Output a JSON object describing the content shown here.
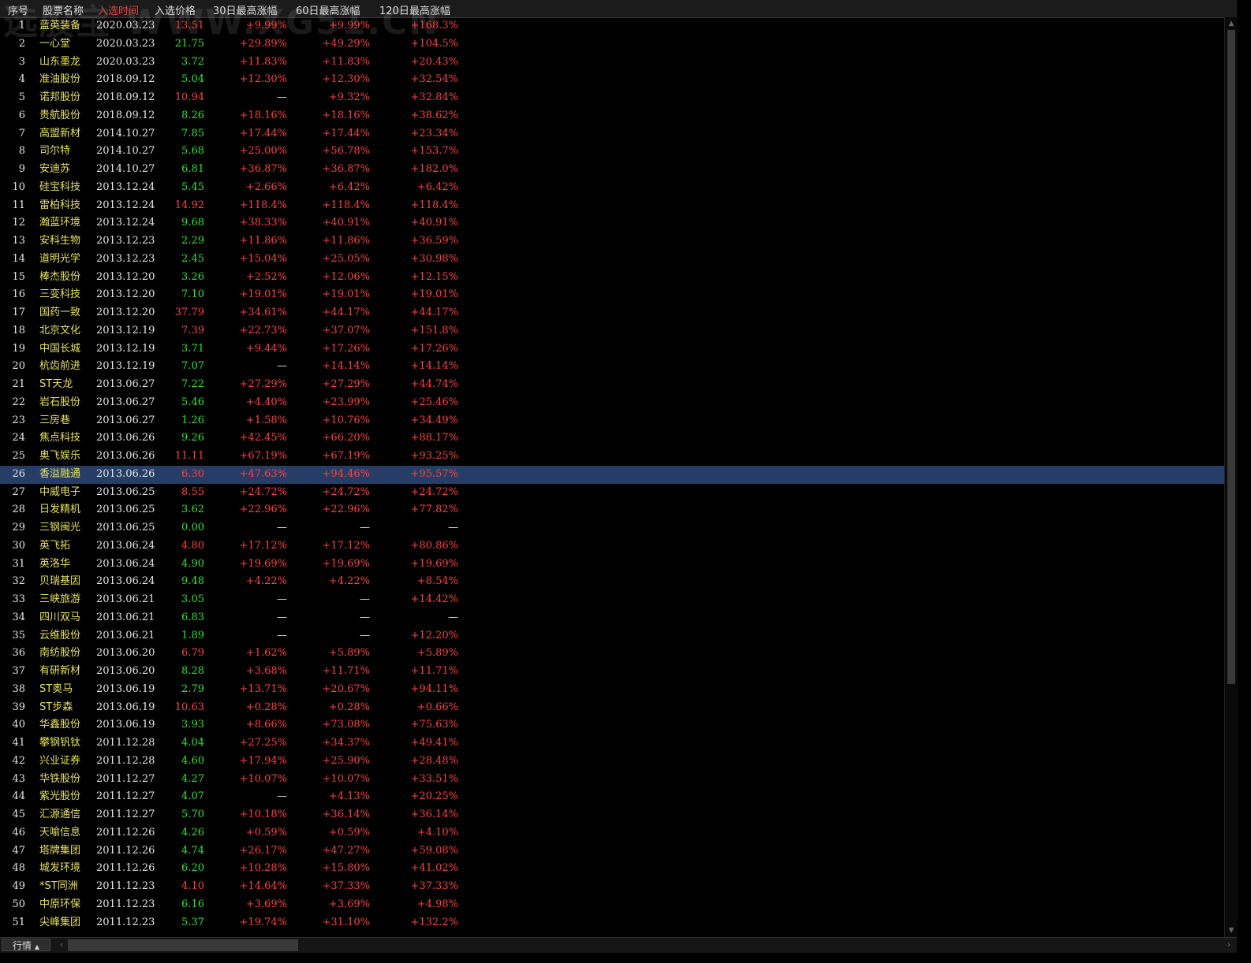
{
  "header": {
    "columns": [
      "序号",
      "股票名称",
      "入选时间",
      "入选价格",
      "30日最高涨幅",
      "60日最高涨幅",
      "120日最高涨幅"
    ],
    "sorted_column_index": 2,
    "watermark": "选股宝 WWW.XG51.CN"
  },
  "colors": {
    "up": "#ff4040",
    "down": "#2ee62e",
    "name": "#e6e15a",
    "selected_row": "#263e66",
    "sorted_header": "#e0443d"
  },
  "selected_row": 26,
  "rows": [
    {
      "idx": "1",
      "name": "蓝英装备",
      "date": "2020.03.23",
      "price": "13.51",
      "price_dir": "up",
      "g30": "+9.99%",
      "g60": "+9.99%",
      "g120": "+168.3%"
    },
    {
      "idx": "2",
      "name": "一心堂",
      "date": "2020.03.23",
      "price": "21.75",
      "price_dir": "down",
      "g30": "+29.89%",
      "g60": "+49.29%",
      "g120": "+104.5%"
    },
    {
      "idx": "3",
      "name": "山东墨龙",
      "date": "2020.03.23",
      "price": "3.72",
      "price_dir": "down",
      "g30": "+11.83%",
      "g60": "+11.83%",
      "g120": "+20.43%"
    },
    {
      "idx": "4",
      "name": "准油股份",
      "date": "2018.09.12",
      "price": "5.04",
      "price_dir": "down",
      "g30": "+12.30%",
      "g60": "+12.30%",
      "g120": "+32.54%"
    },
    {
      "idx": "5",
      "name": "诺邦股份",
      "date": "2018.09.12",
      "price": "10.94",
      "price_dir": "up",
      "g30": "—",
      "g60": "+9.32%",
      "g120": "+32.84%"
    },
    {
      "idx": "6",
      "name": "贵航股份",
      "date": "2018.09.12",
      "price": "8.26",
      "price_dir": "down",
      "g30": "+18.16%",
      "g60": "+18.16%",
      "g120": "+38.62%"
    },
    {
      "idx": "7",
      "name": "高盟新材",
      "date": "2014.10.27",
      "price": "7.85",
      "price_dir": "down",
      "g30": "+17.44%",
      "g60": "+17.44%",
      "g120": "+23.34%"
    },
    {
      "idx": "8",
      "name": "司尔特",
      "date": "2014.10.27",
      "price": "5.68",
      "price_dir": "down",
      "g30": "+25.00%",
      "g60": "+56.78%",
      "g120": "+153.7%"
    },
    {
      "idx": "9",
      "name": "安迪苏",
      "date": "2014.10.27",
      "price": "6.81",
      "price_dir": "down",
      "g30": "+36.87%",
      "g60": "+36.87%",
      "g120": "+182.0%"
    },
    {
      "idx": "10",
      "name": "硅宝科技",
      "date": "2013.12.24",
      "price": "5.45",
      "price_dir": "down",
      "g30": "+2.66%",
      "g60": "+6.42%",
      "g120": "+6.42%"
    },
    {
      "idx": "11",
      "name": "雷柏科技",
      "date": "2013.12.24",
      "price": "14.92",
      "price_dir": "up",
      "g30": "+118.4%",
      "g60": "+118.4%",
      "g120": "+118.4%"
    },
    {
      "idx": "12",
      "name": "瀚蓝环境",
      "date": "2013.12.24",
      "price": "9.68",
      "price_dir": "down",
      "g30": "+38.33%",
      "g60": "+40.91%",
      "g120": "+40.91%"
    },
    {
      "idx": "13",
      "name": "安科生物",
      "date": "2013.12.23",
      "price": "2.29",
      "price_dir": "down",
      "g30": "+11.86%",
      "g60": "+11.86%",
      "g120": "+36.59%"
    },
    {
      "idx": "14",
      "name": "道明光学",
      "date": "2013.12.23",
      "price": "2.45",
      "price_dir": "down",
      "g30": "+15.04%",
      "g60": "+25.05%",
      "g120": "+30.98%"
    },
    {
      "idx": "15",
      "name": "棒杰股份",
      "date": "2013.12.20",
      "price": "3.26",
      "price_dir": "down",
      "g30": "+2.52%",
      "g60": "+12.06%",
      "g120": "+12.15%"
    },
    {
      "idx": "16",
      "name": "三变科技",
      "date": "2013.12.20",
      "price": "7.10",
      "price_dir": "down",
      "g30": "+19.01%",
      "g60": "+19.01%",
      "g120": "+19.01%"
    },
    {
      "idx": "17",
      "name": "国药一致",
      "date": "2013.12.20",
      "price": "37.79",
      "price_dir": "up",
      "g30": "+34.61%",
      "g60": "+44.17%",
      "g120": "+44.17%"
    },
    {
      "idx": "18",
      "name": "北京文化",
      "date": "2013.12.19",
      "price": "7.39",
      "price_dir": "up",
      "g30": "+22.73%",
      "g60": "+37.07%",
      "g120": "+151.8%"
    },
    {
      "idx": "19",
      "name": "中国长城",
      "date": "2013.12.19",
      "price": "3.71",
      "price_dir": "down",
      "g30": "+9.44%",
      "g60": "+17.26%",
      "g120": "+17.26%"
    },
    {
      "idx": "20",
      "name": "杭齿前进",
      "date": "2013.12.19",
      "price": "7.07",
      "price_dir": "down",
      "g30": "—",
      "g60": "+14.14%",
      "g120": "+14.14%"
    },
    {
      "idx": "21",
      "name": "ST天龙",
      "date": "2013.06.27",
      "price": "7.22",
      "price_dir": "down",
      "g30": "+27.29%",
      "g60": "+27.29%",
      "g120": "+44.74%"
    },
    {
      "idx": "22",
      "name": "岩石股份",
      "date": "2013.06.27",
      "price": "5.46",
      "price_dir": "down",
      "g30": "+4.40%",
      "g60": "+23.99%",
      "g120": "+25.46%"
    },
    {
      "idx": "23",
      "name": "三房巷",
      "date": "2013.06.27",
      "price": "1.26",
      "price_dir": "down",
      "g30": "+1.58%",
      "g60": "+10.76%",
      "g120": "+34.49%"
    },
    {
      "idx": "24",
      "name": "焦点科技",
      "date": "2013.06.26",
      "price": "9.26",
      "price_dir": "down",
      "g30": "+42.45%",
      "g60": "+66.20%",
      "g120": "+88.17%"
    },
    {
      "idx": "25",
      "name": "奥飞娱乐",
      "date": "2013.06.26",
      "price": "11.11",
      "price_dir": "up",
      "g30": "+67.19%",
      "g60": "+67.19%",
      "g120": "+93.25%"
    },
    {
      "idx": "26",
      "name": "香溢融通",
      "date": "2013.06.26",
      "price": "6.30",
      "price_dir": "up",
      "g30": "+47.63%",
      "g60": "+94.46%",
      "g120": "+95.57%"
    },
    {
      "idx": "27",
      "name": "中威电子",
      "date": "2013.06.25",
      "price": "8.55",
      "price_dir": "up",
      "g30": "+24.72%",
      "g60": "+24.72%",
      "g120": "+24.72%"
    },
    {
      "idx": "28",
      "name": "日发精机",
      "date": "2013.06.25",
      "price": "3.62",
      "price_dir": "down",
      "g30": "+22.96%",
      "g60": "+22.96%",
      "g120": "+77.82%"
    },
    {
      "idx": "29",
      "name": "三钢闽光",
      "date": "2013.06.25",
      "price": "0.00",
      "price_dir": "down",
      "g30": "—",
      "g60": "—",
      "g120": "—"
    },
    {
      "idx": "30",
      "name": "英飞拓",
      "date": "2013.06.24",
      "price": "4.80",
      "price_dir": "up",
      "g30": "+17.12%",
      "g60": "+17.12%",
      "g120": "+80.86%"
    },
    {
      "idx": "31",
      "name": "英洛华",
      "date": "2013.06.24",
      "price": "4.90",
      "price_dir": "down",
      "g30": "+19.69%",
      "g60": "+19.69%",
      "g120": "+19.69%"
    },
    {
      "idx": "32",
      "name": "贝瑞基因",
      "date": "2013.06.24",
      "price": "9.48",
      "price_dir": "down",
      "g30": "+4.22%",
      "g60": "+4.22%",
      "g120": "+8.54%"
    },
    {
      "idx": "33",
      "name": "三峡旅游",
      "date": "2013.06.21",
      "price": "3.05",
      "price_dir": "down",
      "g30": "—",
      "g60": "—",
      "g120": "+14.42%"
    },
    {
      "idx": "34",
      "name": "四川双马",
      "date": "2013.06.21",
      "price": "6.83",
      "price_dir": "down",
      "g30": "—",
      "g60": "—",
      "g120": "—"
    },
    {
      "idx": "35",
      "name": "云维股份",
      "date": "2013.06.21",
      "price": "1.89",
      "price_dir": "down",
      "g30": "—",
      "g60": "—",
      "g120": "+12.20%"
    },
    {
      "idx": "36",
      "name": "南纺股份",
      "date": "2013.06.20",
      "price": "6.79",
      "price_dir": "up",
      "g30": "+1.62%",
      "g60": "+5.89%",
      "g120": "+5.89%"
    },
    {
      "idx": "37",
      "name": "有研新材",
      "date": "2013.06.20",
      "price": "8.28",
      "price_dir": "down",
      "g30": "+3.68%",
      "g60": "+11.71%",
      "g120": "+11.71%"
    },
    {
      "idx": "38",
      "name": "ST奥马",
      "date": "2013.06.19",
      "price": "2.79",
      "price_dir": "down",
      "g30": "+13.71%",
      "g60": "+20.67%",
      "g120": "+94.11%"
    },
    {
      "idx": "39",
      "name": "ST步森",
      "date": "2013.06.19",
      "price": "10.63",
      "price_dir": "up",
      "g30": "+0.28%",
      "g60": "+0.28%",
      "g120": "+0.66%"
    },
    {
      "idx": "40",
      "name": "华鑫股份",
      "date": "2013.06.19",
      "price": "3.93",
      "price_dir": "down",
      "g30": "+8.66%",
      "g60": "+73.08%",
      "g120": "+75.63%"
    },
    {
      "idx": "41",
      "name": "攀钢钒钛",
      "date": "2011.12.28",
      "price": "4.04",
      "price_dir": "down",
      "g30": "+27.25%",
      "g60": "+34.37%",
      "g120": "+49.41%"
    },
    {
      "idx": "42",
      "name": "兴业证券",
      "date": "2011.12.28",
      "price": "4.60",
      "price_dir": "down",
      "g30": "+17.94%",
      "g60": "+25.90%",
      "g120": "+28.48%"
    },
    {
      "idx": "43",
      "name": "华铁股份",
      "date": "2011.12.27",
      "price": "4.27",
      "price_dir": "down",
      "g30": "+10.07%",
      "g60": "+10.07%",
      "g120": "+33.51%"
    },
    {
      "idx": "44",
      "name": "紫光股份",
      "date": "2011.12.27",
      "price": "4.07",
      "price_dir": "down",
      "g30": "—",
      "g60": "+4.13%",
      "g120": "+20.25%"
    },
    {
      "idx": "45",
      "name": "汇源通信",
      "date": "2011.12.27",
      "price": "5.70",
      "price_dir": "down",
      "g30": "+10.18%",
      "g60": "+36.14%",
      "g120": "+36.14%"
    },
    {
      "idx": "46",
      "name": "天喻信息",
      "date": "2011.12.26",
      "price": "4.26",
      "price_dir": "down",
      "g30": "+0.59%",
      "g60": "+0.59%",
      "g120": "+4.10%"
    },
    {
      "idx": "47",
      "name": "塔牌集团",
      "date": "2011.12.26",
      "price": "4.74",
      "price_dir": "down",
      "g30": "+26.17%",
      "g60": "+47.27%",
      "g120": "+59.08%"
    },
    {
      "idx": "48",
      "name": "城发环境",
      "date": "2011.12.26",
      "price": "6.20",
      "price_dir": "down",
      "g30": "+10.28%",
      "g60": "+15.80%",
      "g120": "+41.02%"
    },
    {
      "idx": "49",
      "name": "*ST同洲",
      "date": "2011.12.23",
      "price": "4.10",
      "price_dir": "up",
      "g30": "+14.64%",
      "g60": "+37.33%",
      "g120": "+37.33%"
    },
    {
      "idx": "50",
      "name": "中原环保",
      "date": "2011.12.23",
      "price": "6.16",
      "price_dir": "down",
      "g30": "+3.69%",
      "g60": "+3.69%",
      "g120": "+4.98%"
    },
    {
      "idx": "51",
      "name": "尖峰集团",
      "date": "2011.12.23",
      "price": "5.37",
      "price_dir": "down",
      "g30": "+19.74%",
      "g60": "+31.10%",
      "g120": "+132.2%"
    }
  ],
  "footer": {
    "tab_label": "行情",
    "tab_arrow": "▲",
    "scroll_left": "‹",
    "scroll_right": "›"
  },
  "scrollbar": {
    "up_arrow": "▲",
    "down_arrow": "▼"
  }
}
